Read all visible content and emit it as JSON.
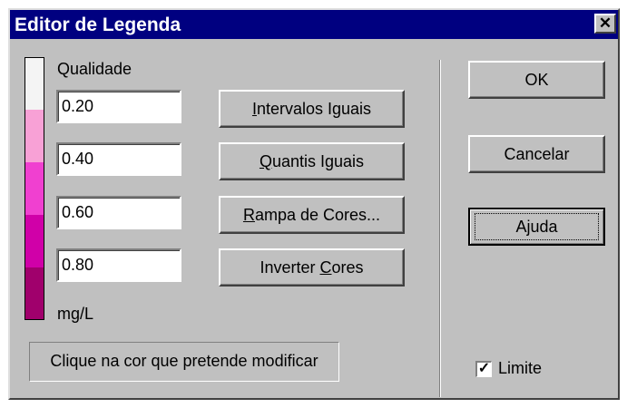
{
  "dialog": {
    "title": "Editor de Legenda",
    "close_glyph": "✕"
  },
  "legend": {
    "header": "Qualidade",
    "unit": "mg/L",
    "colors": [
      "#f4f4f4",
      "#f8a1d6",
      "#f040d0",
      "#d000a8",
      "#a0006c"
    ],
    "breaks": [
      "0.20",
      "0.40",
      "0.60",
      "0.80"
    ]
  },
  "actions": {
    "equal_intervals": {
      "pre": "",
      "key": "I",
      "post": "ntervalos Iguais"
    },
    "equal_quantiles": {
      "pre": "",
      "key": "Q",
      "post": "uantis Iguais"
    },
    "color_ramp": {
      "pre": "",
      "key": "R",
      "post": "ampa de Cores..."
    },
    "invert_colors": {
      "pre": "Inverter ",
      "key": "C",
      "post": "ores"
    }
  },
  "hint": "Clique na cor que pretende modificar",
  "buttons": {
    "ok": "OK",
    "cancel": "Cancelar",
    "help": "Ajuda"
  },
  "limit": {
    "label": "Limite",
    "checked": true,
    "check_glyph": "✓"
  }
}
